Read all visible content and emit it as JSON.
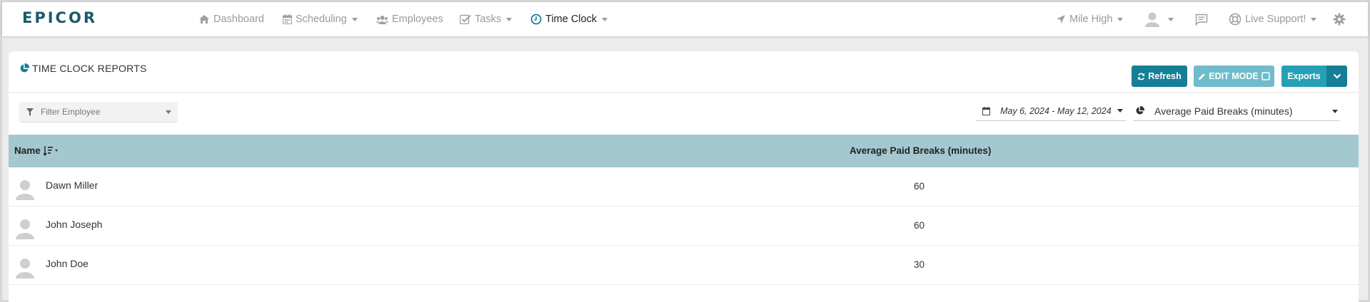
{
  "brand": {
    "logo_text": "epicor",
    "accent": "#157f96"
  },
  "nav": {
    "dashboard": "Dashboard",
    "scheduling": "Scheduling",
    "employees": "Employees",
    "tasks": "Tasks",
    "time_clock": "Time Clock"
  },
  "top_right": {
    "location": "Mile High",
    "live_support": "Live Support!"
  },
  "panel": {
    "title": "TIME CLOCK REPORTS",
    "refresh": "Refresh",
    "edit_mode": "EDIT MODE",
    "exports": "Exports",
    "filter_placeholder": "Filter Employee",
    "date_range": "May 6, 2024 - May 12, 2024",
    "metric": "Average Paid Breaks (minutes)"
  },
  "table": {
    "col_name": "Name",
    "col_value": "Average Paid Breaks (minutes)",
    "rows": [
      {
        "name": "Dawn Miller",
        "value": "60"
      },
      {
        "name": "John Joseph",
        "value": "60"
      },
      {
        "name": "John Doe",
        "value": "30"
      }
    ]
  }
}
